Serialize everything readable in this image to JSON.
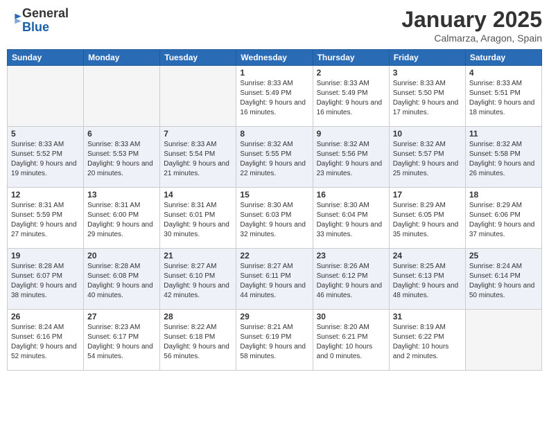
{
  "logo": {
    "general": "General",
    "blue": "Blue"
  },
  "title": "January 2025",
  "location": "Calmarza, Aragon, Spain",
  "weekdays": [
    "Sunday",
    "Monday",
    "Tuesday",
    "Wednesday",
    "Thursday",
    "Friday",
    "Saturday"
  ],
  "weeks": [
    [
      {
        "day": "",
        "empty": true
      },
      {
        "day": "",
        "empty": true
      },
      {
        "day": "",
        "empty": true
      },
      {
        "day": "1",
        "sunrise": "8:33 AM",
        "sunset": "5:49 PM",
        "daylight": "9 hours and 16 minutes."
      },
      {
        "day": "2",
        "sunrise": "8:33 AM",
        "sunset": "5:49 PM",
        "daylight": "9 hours and 16 minutes."
      },
      {
        "day": "3",
        "sunrise": "8:33 AM",
        "sunset": "5:50 PM",
        "daylight": "9 hours and 17 minutes."
      },
      {
        "day": "4",
        "sunrise": "8:33 AM",
        "sunset": "5:51 PM",
        "daylight": "9 hours and 18 minutes."
      }
    ],
    [
      {
        "day": "5",
        "sunrise": "8:33 AM",
        "sunset": "5:52 PM",
        "daylight": "9 hours and 19 minutes."
      },
      {
        "day": "6",
        "sunrise": "8:33 AM",
        "sunset": "5:53 PM",
        "daylight": "9 hours and 20 minutes."
      },
      {
        "day": "7",
        "sunrise": "8:33 AM",
        "sunset": "5:54 PM",
        "daylight": "9 hours and 21 minutes."
      },
      {
        "day": "8",
        "sunrise": "8:32 AM",
        "sunset": "5:55 PM",
        "daylight": "9 hours and 22 minutes."
      },
      {
        "day": "9",
        "sunrise": "8:32 AM",
        "sunset": "5:56 PM",
        "daylight": "9 hours and 23 minutes."
      },
      {
        "day": "10",
        "sunrise": "8:32 AM",
        "sunset": "5:57 PM",
        "daylight": "9 hours and 25 minutes."
      },
      {
        "day": "11",
        "sunrise": "8:32 AM",
        "sunset": "5:58 PM",
        "daylight": "9 hours and 26 minutes."
      }
    ],
    [
      {
        "day": "12",
        "sunrise": "8:31 AM",
        "sunset": "5:59 PM",
        "daylight": "9 hours and 27 minutes."
      },
      {
        "day": "13",
        "sunrise": "8:31 AM",
        "sunset": "6:00 PM",
        "daylight": "9 hours and 29 minutes."
      },
      {
        "day": "14",
        "sunrise": "8:31 AM",
        "sunset": "6:01 PM",
        "daylight": "9 hours and 30 minutes."
      },
      {
        "day": "15",
        "sunrise": "8:30 AM",
        "sunset": "6:03 PM",
        "daylight": "9 hours and 32 minutes."
      },
      {
        "day": "16",
        "sunrise": "8:30 AM",
        "sunset": "6:04 PM",
        "daylight": "9 hours and 33 minutes."
      },
      {
        "day": "17",
        "sunrise": "8:29 AM",
        "sunset": "6:05 PM",
        "daylight": "9 hours and 35 minutes."
      },
      {
        "day": "18",
        "sunrise": "8:29 AM",
        "sunset": "6:06 PM",
        "daylight": "9 hours and 37 minutes."
      }
    ],
    [
      {
        "day": "19",
        "sunrise": "8:28 AM",
        "sunset": "6:07 PM",
        "daylight": "9 hours and 38 minutes."
      },
      {
        "day": "20",
        "sunrise": "8:28 AM",
        "sunset": "6:08 PM",
        "daylight": "9 hours and 40 minutes."
      },
      {
        "day": "21",
        "sunrise": "8:27 AM",
        "sunset": "6:10 PM",
        "daylight": "9 hours and 42 minutes."
      },
      {
        "day": "22",
        "sunrise": "8:27 AM",
        "sunset": "6:11 PM",
        "daylight": "9 hours and 44 minutes."
      },
      {
        "day": "23",
        "sunrise": "8:26 AM",
        "sunset": "6:12 PM",
        "daylight": "9 hours and 46 minutes."
      },
      {
        "day": "24",
        "sunrise": "8:25 AM",
        "sunset": "6:13 PM",
        "daylight": "9 hours and 48 minutes."
      },
      {
        "day": "25",
        "sunrise": "8:24 AM",
        "sunset": "6:14 PM",
        "daylight": "9 hours and 50 minutes."
      }
    ],
    [
      {
        "day": "26",
        "sunrise": "8:24 AM",
        "sunset": "6:16 PM",
        "daylight": "9 hours and 52 minutes."
      },
      {
        "day": "27",
        "sunrise": "8:23 AM",
        "sunset": "6:17 PM",
        "daylight": "9 hours and 54 minutes."
      },
      {
        "day": "28",
        "sunrise": "8:22 AM",
        "sunset": "6:18 PM",
        "daylight": "9 hours and 56 minutes."
      },
      {
        "day": "29",
        "sunrise": "8:21 AM",
        "sunset": "6:19 PM",
        "daylight": "9 hours and 58 minutes."
      },
      {
        "day": "30",
        "sunrise": "8:20 AM",
        "sunset": "6:21 PM",
        "daylight": "10 hours and 0 minutes."
      },
      {
        "day": "31",
        "sunrise": "8:19 AM",
        "sunset": "6:22 PM",
        "daylight": "10 hours and 2 minutes."
      },
      {
        "day": "",
        "empty": true
      }
    ]
  ],
  "labels": {
    "sunrise": "Sunrise:",
    "sunset": "Sunset:",
    "daylight": "Daylight:"
  }
}
